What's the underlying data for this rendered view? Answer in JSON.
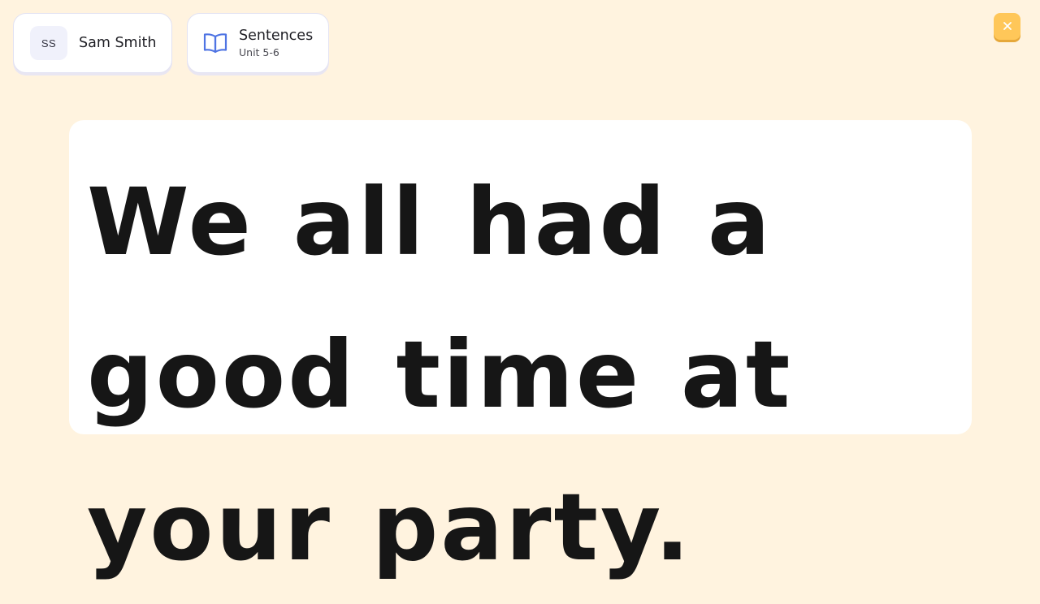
{
  "user": {
    "initials": "SS",
    "name": "Sam Smith"
  },
  "lesson": {
    "icon": "book-open-icon",
    "title": "Sentences",
    "subtitle": "Unit 5-6"
  },
  "close_button": {
    "icon": "close-icon",
    "color": "#ffc759"
  },
  "sentence": {
    "text": "We all had a good time at your party."
  },
  "colors": {
    "background": "#fff3df",
    "card": "#ffffff",
    "text": "#161616",
    "book_icon": "#4f74e3"
  }
}
